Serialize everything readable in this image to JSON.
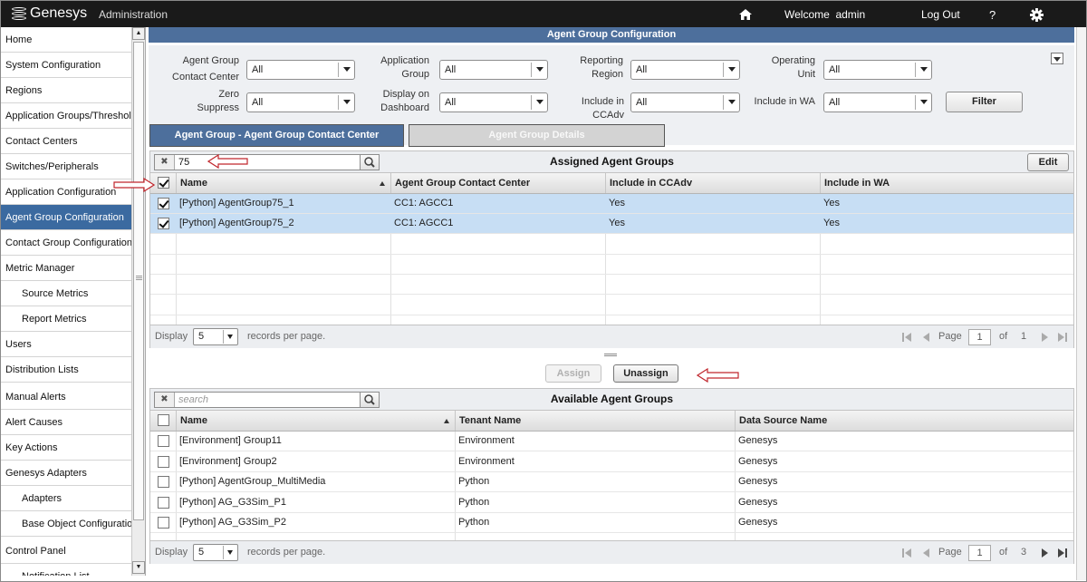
{
  "header": {
    "brand": "Genesys",
    "section": "Administration",
    "welcome": "Welcome  admin",
    "logout": "Log Out",
    "help": "?"
  },
  "sidebar": {
    "items": [
      {
        "label": "Home",
        "level": 0,
        "active": false
      },
      {
        "label": "System Configuration",
        "level": 0,
        "active": false
      },
      {
        "label": "Regions",
        "level": 0,
        "active": false
      },
      {
        "label": "Application Groups/Thresholds",
        "level": 0,
        "active": false
      },
      {
        "label": "Contact Centers",
        "level": 0,
        "active": false
      },
      {
        "label": "Switches/Peripherals",
        "level": 0,
        "active": false
      },
      {
        "label": "Application Configuration",
        "level": 0,
        "active": false
      },
      {
        "label": "Agent Group Configuration",
        "level": 0,
        "active": true
      },
      {
        "label": "Contact Group Configuration",
        "level": 0,
        "active": false
      },
      {
        "label": "Metric Manager",
        "level": 0,
        "active": false
      },
      {
        "label": "Source Metrics",
        "level": 1,
        "active": false
      },
      {
        "label": "Report Metrics",
        "level": 1,
        "active": false
      },
      {
        "label": "Users",
        "level": 0,
        "active": false
      },
      {
        "label": "Distribution Lists",
        "level": 0,
        "active": false
      },
      {
        "label": "Manual Alerts",
        "level": 0,
        "active": false
      },
      {
        "label": "Alert Causes",
        "level": 0,
        "active": false
      },
      {
        "label": "Key Actions",
        "level": 0,
        "active": false
      },
      {
        "label": "Genesys Adapters",
        "level": 0,
        "active": false
      },
      {
        "label": "Adapters",
        "level": 1,
        "active": false
      },
      {
        "label": "Base Object Configuration",
        "level": 1,
        "active": false
      },
      {
        "label": "Control Panel",
        "level": 0,
        "active": false
      },
      {
        "label": "Notification List",
        "level": 1,
        "active": false
      }
    ]
  },
  "page": {
    "title": "Agent Group Configuration"
  },
  "filters": {
    "agent_group_contact_center": {
      "label1": "Agent Group",
      "label2": "Contact Center",
      "value": "All"
    },
    "application_group": {
      "label1": "Application",
      "label2": "Group",
      "value": "All"
    },
    "reporting_region": {
      "label1": "Reporting",
      "label2": "Region",
      "value": "All"
    },
    "operating_unit": {
      "label1": "Operating",
      "label2": "Unit",
      "value": "All"
    },
    "zero_suppress": {
      "label1": "Zero",
      "label2": "Suppress",
      "value": "All"
    },
    "display_on_dashboard": {
      "label1": "Display on",
      "label2": "Dashboard",
      "value": "All"
    },
    "include_in_ccadv": {
      "label": "Include in CCAdv",
      "value": "All"
    },
    "include_in_wa": {
      "label": "Include in WA",
      "value": "All"
    },
    "filter_button": "Filter"
  },
  "tabs": [
    {
      "label": "Agent Group - Agent Group Contact Center",
      "active": true
    },
    {
      "label": "Agent Group Details",
      "active": false
    }
  ],
  "assigned": {
    "title": "Assigned Agent Groups",
    "search_value": "75",
    "edit_button": "Edit",
    "columns": [
      "Name",
      "Agent Group Contact Center",
      "Include in CCAdv",
      "Include in WA"
    ],
    "rows": [
      {
        "name": "[Python] AgentGroup75_1",
        "agcc": "CC1: AGCC1",
        "ccadv": "Yes",
        "wa": "Yes"
      },
      {
        "name": "[Python] AgentGroup75_2",
        "agcc": "CC1: AGCC1",
        "ccadv": "Yes",
        "wa": "Yes"
      }
    ],
    "pager": {
      "display": "Display",
      "per_page": "5",
      "records": "records per page.",
      "page": "Page",
      "current": "1",
      "of": "of",
      "total": "1"
    }
  },
  "actions": {
    "assign": "Assign",
    "unassign": "Unassign"
  },
  "available": {
    "title": "Available Agent Groups",
    "search_placeholder": "search",
    "columns": [
      "Name",
      "Tenant Name",
      "Data Source Name"
    ],
    "rows": [
      {
        "name": "[Environment] Group11",
        "tenant": "Environment",
        "source": "Genesys"
      },
      {
        "name": "[Environment] Group2",
        "tenant": "Environment",
        "source": "Genesys"
      },
      {
        "name": "[Python] AgentGroup_MultiMedia",
        "tenant": "Python",
        "source": "Genesys"
      },
      {
        "name": "[Python] AG_G3Sim_P1",
        "tenant": "Python",
        "source": "Genesys"
      },
      {
        "name": "[Python] AG_G3Sim_P2",
        "tenant": "Python",
        "source": "Genesys"
      }
    ],
    "pager": {
      "display": "Display",
      "per_page": "5",
      "records": "records per page.",
      "page": "Page",
      "current": "1",
      "of": "of",
      "total": "3"
    }
  },
  "colors": {
    "accent": "#4d6f9c",
    "active_nav": "#3b6aa0",
    "selected_row": "#c7def4",
    "annotation": "#c0262c"
  }
}
